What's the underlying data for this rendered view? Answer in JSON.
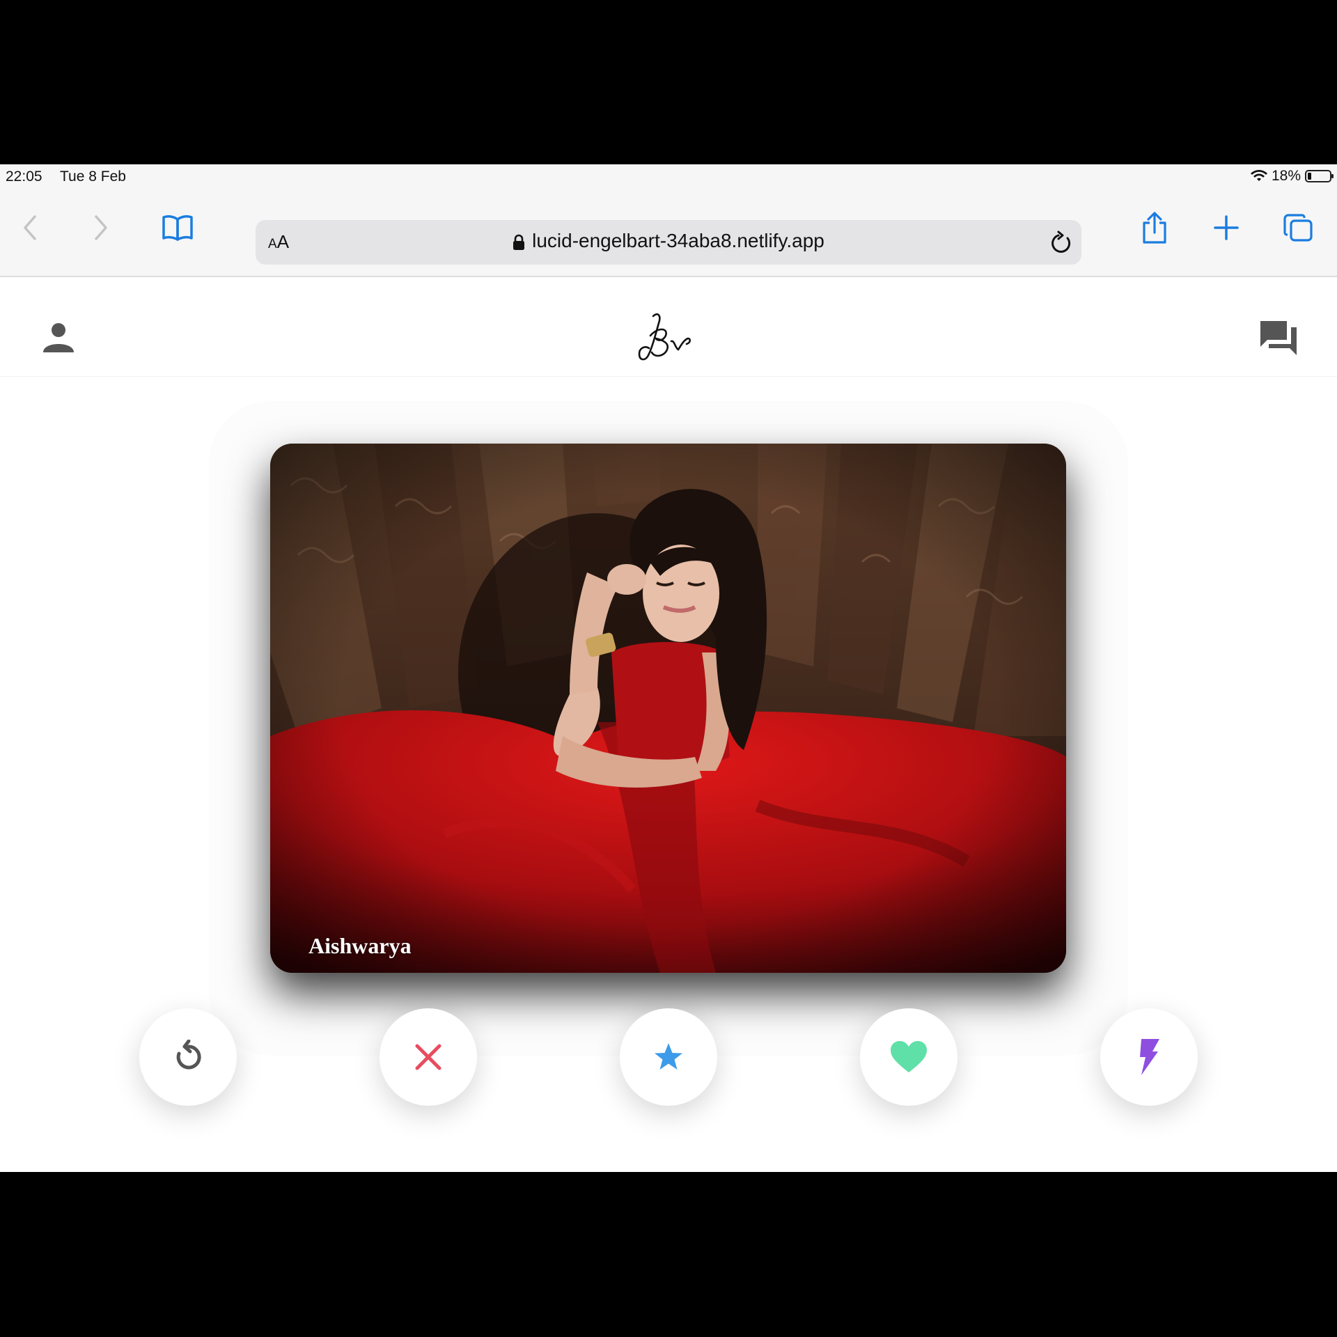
{
  "status": {
    "time": "22:05",
    "date": "Tue 8 Feb",
    "battery": "18%"
  },
  "browser": {
    "text_size_label": {
      "small": "A",
      "large": "A"
    },
    "url": "lucid-engelbart-34aba8.netlify.app"
  },
  "app": {
    "card": {
      "name": "Aishwarya"
    },
    "colors": {
      "nope": "#e84c5f",
      "star": "#3d9be9",
      "like": "#5fe0a8",
      "boost": "#8e4fe0"
    }
  }
}
